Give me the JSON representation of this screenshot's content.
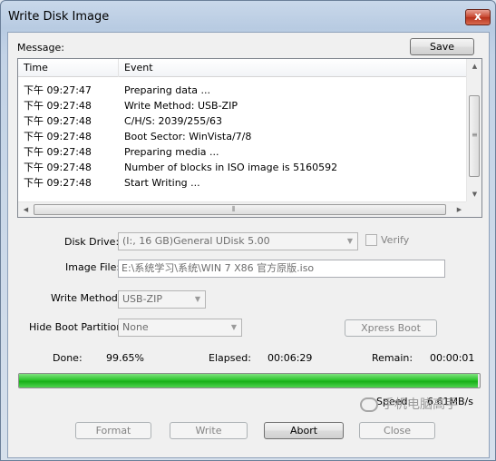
{
  "window": {
    "title": "Write Disk Image",
    "close_glyph": "x"
  },
  "message": {
    "label": "Message:",
    "save_label": "Save",
    "columns": [
      "Time",
      "Event"
    ],
    "rows": [
      {
        "time": "下午 09:27:47",
        "event": "Preparing data ..."
      },
      {
        "time": "下午 09:27:48",
        "event": "Write Method: USB-ZIP"
      },
      {
        "time": "下午 09:27:48",
        "event": "C/H/S: 2039/255/63"
      },
      {
        "time": "下午 09:27:48",
        "event": "Boot Sector: WinVista/7/8"
      },
      {
        "time": "下午 09:27:48",
        "event": "Preparing media ..."
      },
      {
        "time": "下午 09:27:48",
        "event": "Number of blocks in ISO image is 5160592"
      },
      {
        "time": "下午 09:27:48",
        "event": "Start Writing ..."
      }
    ]
  },
  "form": {
    "disk_drive_label": "Disk Drive:",
    "disk_drive_value": "(I:, 16 GB)General UDisk          5.00",
    "verify_label": "Verify",
    "image_file_label": "Image File:",
    "image_file_value": "E:\\系统学习\\系统\\WIN 7    X86 官方原版.iso",
    "write_method_label": "Write Method:",
    "write_method_value": "USB-ZIP",
    "hide_boot_label": "Hide Boot Partition:",
    "hide_boot_value": "None",
    "xpress_boot_label": "Xpress Boot"
  },
  "status": {
    "done_label": "Done:",
    "done_value": "99.65%",
    "elapsed_label": "Elapsed:",
    "elapsed_value": "00:06:29",
    "remain_label": "Remain:",
    "remain_value": "00:00:01",
    "progress_fraction": 0.9965,
    "speed_label": "Speed:",
    "speed_value": "6.61MB/s"
  },
  "buttons": {
    "format": "Format",
    "write": "Write",
    "abort": "Abort",
    "close": "Close"
  },
  "watermark": {
    "text": "手机电脑高手"
  },
  "colors": {
    "progress": "#2cc52c",
    "close_button": "#c7452e"
  }
}
